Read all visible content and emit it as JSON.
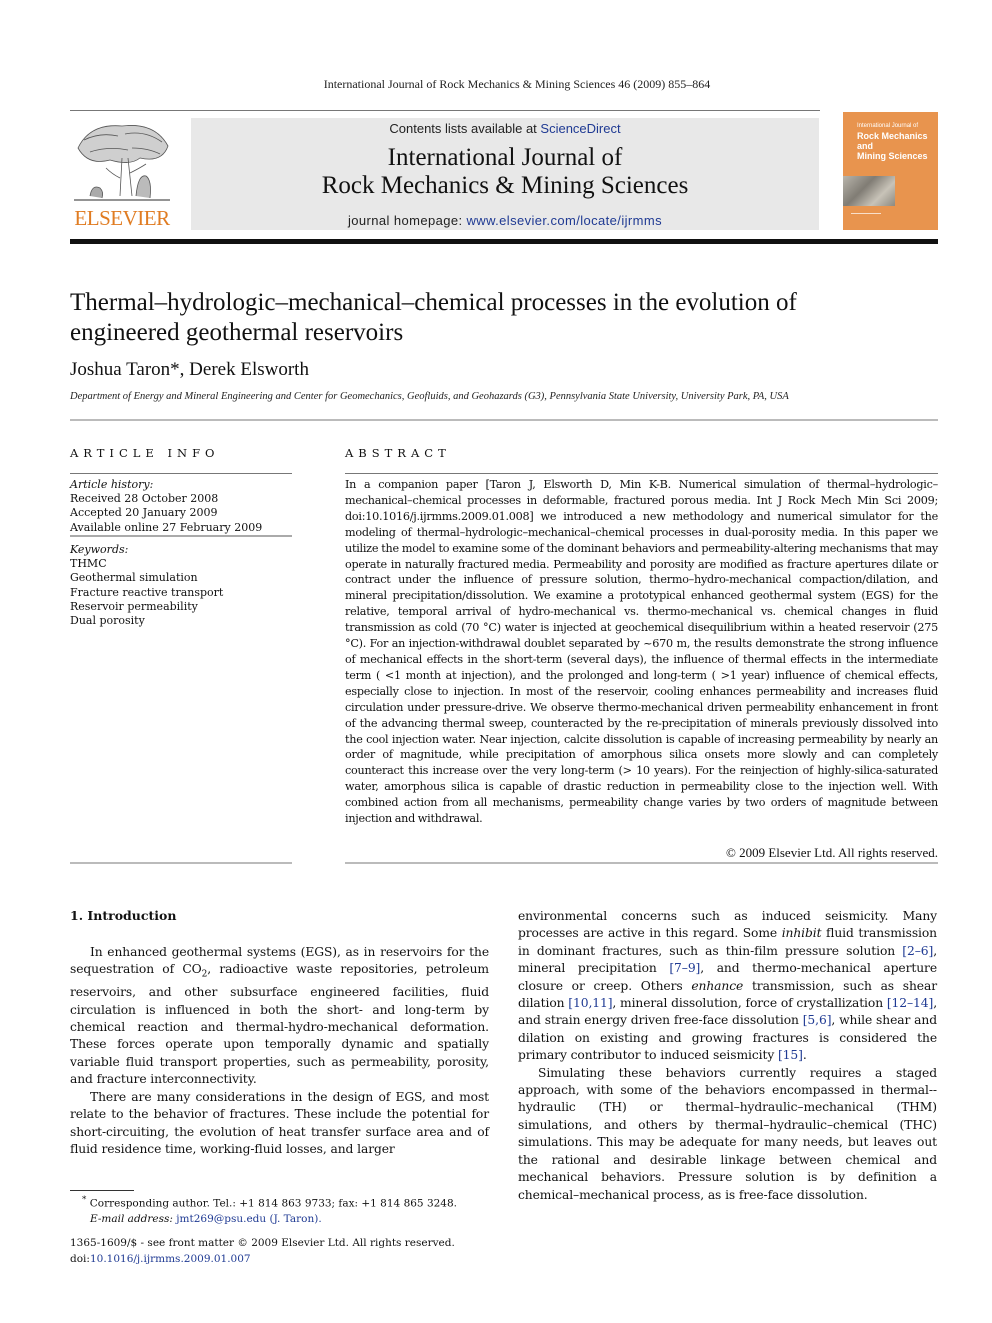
{
  "running_head": "International Journal of Rock Mechanics & Mining Sciences 46 (2009) 855–864",
  "masthead": {
    "publisher_logo_text": "ELSEVIER",
    "contents_prefix": "Contents lists available at ",
    "contents_link": "ScienceDirect",
    "journal_title_line1": "International Journal of",
    "journal_title_line2": "Rock Mechanics & Mining Sciences",
    "homepage_prefix": "journal homepage: ",
    "homepage_link": "www.elsevier.com/locate/ijrmms",
    "cover": {
      "small_line": "International Journal of",
      "line1": "Rock Mechanics",
      "line2": "and",
      "line3": "Mining Sciences"
    },
    "colors": {
      "elsevier_orange": "#e07c22",
      "cover_orange": "#e8944e",
      "link_blue": "#1f3a93",
      "box_gray": "#e8e8e8"
    }
  },
  "article": {
    "title_line1": "Thermal–hydrologic–mechanical–chemical processes in the evolution of",
    "title_line2": "engineered geothermal reservoirs",
    "author1": "Joshua Taron",
    "author1_mark": "*",
    "author_sep": ", ",
    "author2": "Derek Elsworth",
    "affiliation": "Department of Energy and Mineral Engineering and Center for Geomechanics, Geofluids, and Geohazards (G3), Pennsylvania State University, University Park, PA, USA"
  },
  "article_info": {
    "heading": "ARTICLE INFO",
    "history_label": "Article history:",
    "history": [
      "Received 28 October 2008",
      "Accepted 20 January 2009",
      "Available online 27 February 2009"
    ],
    "keywords_label": "Keywords:",
    "keywords": [
      "THMC",
      "Geothermal simulation",
      "Fracture reactive transport",
      "Reservoir permeability",
      "Dual porosity"
    ]
  },
  "abstract": {
    "heading": "ABSTRACT",
    "text": "In a companion paper [Taron J, Elsworth D, Min K-B. Numerical simulation of thermal–hydrologic–mechanical–chemical processes in deformable, fractured porous media. Int J Rock Mech Min Sci 2009; doi:10.1016/j.ijrmms.2009.01.008] we introduced a new methodology and numerical simulator for the modeling of thermal–hydrologic–mechanical–chemical processes in dual-porosity media. In this paper we utilize the model to examine some of the dominant behaviors and permeability-altering mechanisms that may operate in naturally fractured media. Permeability and porosity are modified as fracture apertures dilate or contract under the influence of pressure solution, thermo–hydro-mechanical compaction/dilation, and mineral precipitation/dissolution. We examine a prototypical enhanced geothermal system (EGS) for the relative, temporal arrival of hydro-mechanical vs. thermo-mechanical vs. chemical changes in fluid transmission as cold (70 °C) water is injected at geochemical disequilibrium within a heated reservoir (275 °C). For an injection-withdrawal doublet separated by ~670 m, the results demonstrate the strong influence of mechanical effects in the short-term (several days), the influence of thermal effects in the intermediate term ( <1 month at injection), and the prolonged and long-term ( >1 year) influence of chemical effects, especially close to injection. In most of the reservoir, cooling enhances permeability and increases fluid circulation under pressure-drive. We observe thermo-mechanical driven permeability enhancement in front of the advancing thermal sweep, counteracted by the re-precipitation of minerals previously dissolved into the cool injection water. Near injection, calcite dissolution is capable of increasing permeability by nearly an order of magnitude, while precipitation of amorphous silica onsets more slowly and can completely counteract this increase over the very long-term (> 10 years). For the reinjection of highly-silica-saturated water, amorphous silica is capable of drastic reduction in permeability close to the injection well. With combined action from all mechanisms, permeability change varies by two orders of magnitude between injection and withdrawal.",
    "copyright": "© 2009 Elsevier Ltd. All rights reserved."
  },
  "body": {
    "section_heading": "1.  Introduction",
    "left_p1": {
      "a": "In enhanced geothermal systems (EGS), as in reservoirs for the sequestration of CO",
      "sub": "2",
      "b": ", radioactive waste repositories, petroleum reservoirs, and other subsurface engineered facilities, fluid circulation is influenced in both the short- and long-term by chemical reaction and thermal-hydro-mechanical deformation. These forces operate upon temporally dynamic and spatially variable fluid transport properties, such as permeability, porosity, and fracture interconnectivity."
    },
    "left_p2": "There are many considerations in the design of EGS, and most relate to the behavior of fractures. These include the potential for short-circuiting, the evolution of heat transfer surface area and of fluid residence time, working-fluid losses, and larger",
    "right_p1": {
      "t1": "environmental concerns such as induced seismicity. Many processes are active in this regard. Some ",
      "em1": "inhibit",
      "t2": " fluid transmission in dominant fractures, such as thin-film pressure solution ",
      "ref1": "[2–6]",
      "t3": ", mineral precipitation ",
      "ref2": "[7–9]",
      "t4": ", and thermo-mechanical aperture closure or creep. Others ",
      "em2": "enhance",
      "t5": " transmission, such as shear dilation ",
      "ref3": "[10,11]",
      "t6": ", mineral dissolution, force of crystallization ",
      "ref4": "[12–14]",
      "t7": ", and strain energy driven free-face dissolution ",
      "ref5": "[5,6]",
      "t8": ", while shear and dilation on existing and growing fractures is considered the primary contributor to induced seismicity ",
      "ref6": "[15]",
      "t9": "."
    },
    "right_p2": "Simulating these behaviors currently requires a staged approach, with some of the behaviors encompassed in thermal--hydraulic (TH) or thermal–hydraulic–mechanical (THM) simulations, and others by thermal–hydraulic–chemical (THC) simulations. This may be adequate for many needs, but leaves out the rational and desirable linkage between chemical and mechanical behaviors. Pressure solution is by definition a chemical–mechanical process, as is free-face dissolution."
  },
  "footnote": {
    "mark": "*",
    "text": " Corresponding author. Tel.: +1 814 863 9733; fax: +1 814 865 3248.",
    "email_label": "E-mail address: ",
    "email": "jmt269@psu.edu",
    "email_name": " (J. Taron)."
  },
  "front_matter": {
    "issn_line": "1365-1609/$ - see front matter © 2009 Elsevier Ltd. All rights reserved.",
    "doi_prefix": "doi:",
    "doi_link": "10.1016/j.ijrmms.2009.01.007"
  }
}
